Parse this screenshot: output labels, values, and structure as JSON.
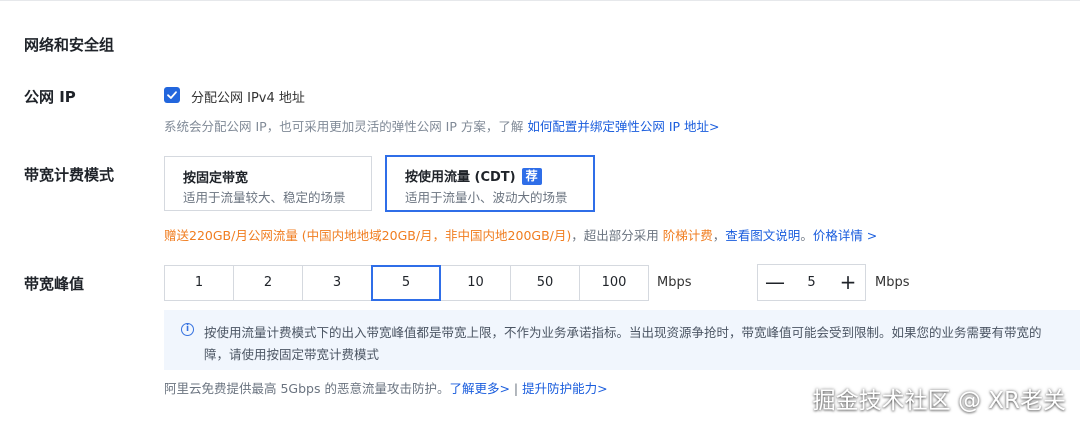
{
  "section": {
    "title": "网络和安全组"
  },
  "public_ip": {
    "label": "公网 IP",
    "checkbox_label": "分配公网 IPv4 地址",
    "checked": true,
    "hint": "系统会分配公网 IP，也可采用更加灵活的弹性公网 IP 方案，了解 ",
    "hint_link": "如何配置并绑定弹性公网 IP 地址>"
  },
  "billing": {
    "label": "带宽计费模式",
    "options": [
      {
        "title": "按固定带宽",
        "desc": "适用于流量较大、稳定的场景",
        "selected": false
      },
      {
        "title": "按使用流量 (CDT)",
        "badge": "荐",
        "desc": "适用于流量小、波动大的场景",
        "selected": true
      }
    ],
    "promo_orange": "赠送220GB/月公网流量 (中国内地地域20GB/月，非中国内地200GB/月)",
    "promo_mid": "，超出部分采用 ",
    "promo_orange2": "阶梯计费",
    "promo_sep": "，",
    "promo_link1": "查看图文说明",
    "promo_dot": "。",
    "promo_link2": "价格详情 >"
  },
  "bandwidth": {
    "label": "带宽峰值",
    "options": [
      "1",
      "2",
      "3",
      "5",
      "10",
      "50",
      "100"
    ],
    "selected": "5",
    "unit": "Mbps",
    "stepper_value": "5",
    "stepper_minus": "—",
    "stepper_plus": "+",
    "stepper_unit": "Mbps"
  },
  "notice": {
    "icon": "info-icon",
    "line1": "按使用流量计费模式下的出入带宽峰值都是带宽上限，不作为业务承诺指标。当出现资源争抢时，带宽峰值可能会受到限制。如果您的业务需要有带宽的",
    "line2": "障，请使用按固定带宽计费模式"
  },
  "footer": {
    "text": "阿里云免费提供最高 5Gbps 的恶意流量攻击防护。",
    "link1": "了解更多>",
    "sep": " | ",
    "link2": "提升防护能力>"
  },
  "watermark": "掘金技术社区 @ XR老关",
  "colors": {
    "accent": "#2f6ee8",
    "link": "#1a5ddd",
    "promo": "#f07d20",
    "notice_bg": "#f1f6fd"
  }
}
